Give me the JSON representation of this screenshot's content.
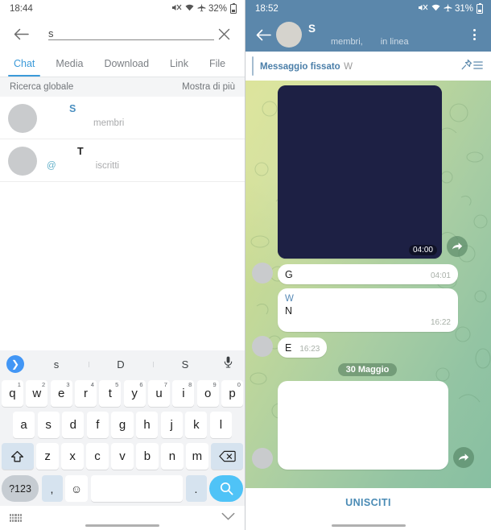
{
  "left": {
    "status": {
      "time": "18:44",
      "battery": "32%",
      "icons": [
        "mute-icon",
        "wifi-icon",
        "airplane-icon",
        "battery-icon"
      ]
    },
    "search": {
      "value": "s",
      "placeholder": "",
      "back_icon": "back-arrow-icon",
      "clear_icon": "close-icon"
    },
    "tabs": [
      {
        "label": "Chat",
        "active": true
      },
      {
        "label": "Media",
        "active": false
      },
      {
        "label": "Download",
        "active": false
      },
      {
        "label": "Link",
        "active": false
      },
      {
        "label": "File",
        "active": false
      }
    ],
    "section": {
      "title": "Ricerca globale",
      "action": "Mostra di più"
    },
    "results": [
      {
        "title": "S",
        "subtitle": "membri",
        "title_color": "#4a8fc0"
      },
      {
        "title": "T",
        "at": "@",
        "subtitle": "iscritti",
        "title_color": "#232323"
      }
    ],
    "keyboard": {
      "suggestions": [
        "s",
        "D",
        "S"
      ],
      "send_icon": "chevron-right-icon",
      "mic_icon": "microphone-icon",
      "row1": [
        {
          "k": "q",
          "n": "1"
        },
        {
          "k": "w",
          "n": "2"
        },
        {
          "k": "e",
          "n": "3"
        },
        {
          "k": "r",
          "n": "4"
        },
        {
          "k": "t",
          "n": "5"
        },
        {
          "k": "y",
          "n": "6"
        },
        {
          "k": "u",
          "n": "7"
        },
        {
          "k": "i",
          "n": "8"
        },
        {
          "k": "o",
          "n": "9"
        },
        {
          "k": "p",
          "n": "0"
        }
      ],
      "row2": [
        "a",
        "s",
        "d",
        "f",
        "g",
        "h",
        "j",
        "k",
        "l"
      ],
      "row3": [
        "z",
        "x",
        "c",
        "v",
        "b",
        "n",
        "m"
      ],
      "shift_icon": "shift-up-icon",
      "backspace_icon": "backspace-icon",
      "symbols_key": "?123",
      "comma_key": ",",
      "emoji_icon": "smiley-icon",
      "period_key": ".",
      "search_icon": "search-icon",
      "space_label": ""
    },
    "navbar": {
      "keyboard_icon": "keyboard-icon",
      "hide_icon": "chevron-down-icon"
    }
  },
  "right": {
    "status": {
      "time": "18:52",
      "battery": "31%",
      "icons": [
        "mute-icon",
        "wifi-icon",
        "airplane-icon",
        "battery-icon"
      ]
    },
    "header": {
      "back_icon": "back-arrow-icon",
      "title": "S",
      "sub_members": "membri,",
      "sub_online": "in linea",
      "menu_icon": "overflow-menu-icon"
    },
    "pinned": {
      "label": "Messaggio fissato",
      "text": "W",
      "pin_icon": "pin-icon",
      "list_icon": "list-icon"
    },
    "messages": [
      {
        "type": "media",
        "time": "04:00",
        "forward_icon": "forward-arrow-icon"
      },
      {
        "type": "text",
        "text": "G",
        "time": "04:01",
        "inline": true
      },
      {
        "type": "text",
        "name": "W",
        "text": "N",
        "time": "16:22",
        "inline": false
      },
      {
        "type": "text",
        "text": "E",
        "time": "16:23",
        "inline": true
      }
    ],
    "date_divider": "30 Maggio",
    "blank_bubble": {
      "forward_icon": "forward-arrow-icon"
    },
    "join": {
      "label": "UNISCITI"
    },
    "colors": {
      "header": "#5b87ab",
      "accent": "#4a8bb5",
      "bubble": "#ffffff"
    }
  }
}
